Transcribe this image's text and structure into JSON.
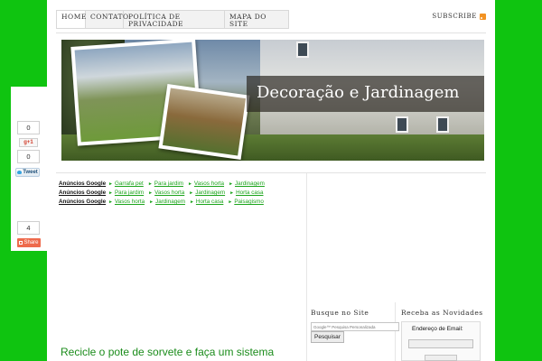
{
  "nav": {
    "items": [
      {
        "label": "Home"
      },
      {
        "label": "Contato"
      },
      {
        "label": "Política de Privacidade"
      },
      {
        "label": "Mapa do Site"
      }
    ],
    "subscribe_label": "SUBSCRIBE"
  },
  "header": {
    "title": "Decoração e Jardinagem"
  },
  "ads": {
    "rows": [
      {
        "label": "Anúncios Google",
        "links": [
          "Garrafa pet",
          "Para jardim",
          "Vasos horta",
          "Jardinagem"
        ]
      },
      {
        "label": "Anúncios Google",
        "links": [
          "Para jardim",
          "Vasos horta",
          "Jardinagem",
          "Horta casa"
        ]
      },
      {
        "label": "Anúncios Google",
        "links": [
          "Vasos horta",
          "Jardinagem",
          "Horta casa",
          "Paisagismo"
        ]
      }
    ]
  },
  "post": {
    "title": "Recicle o pote de sorvete e faça um sistema"
  },
  "sidebar": {
    "search": {
      "title": "Busque no Site",
      "placeholder": "Google™ Pesquisa Personalizada",
      "button_label": "Pesquisar"
    },
    "newsletter": {
      "title": "Receba as Novidades",
      "email_label": "Endereço de Email:"
    }
  },
  "sharebar": {
    "count_top": "0",
    "gplus_label": "g+1",
    "count_tweet": "0",
    "tweet_label": "Tweet",
    "count_share": "4",
    "share_label": "Share"
  },
  "colors": {
    "background": "#0fc410",
    "link": "#1ca51c",
    "post_title": "#1b8c1b",
    "share": "#ee6a4c"
  }
}
